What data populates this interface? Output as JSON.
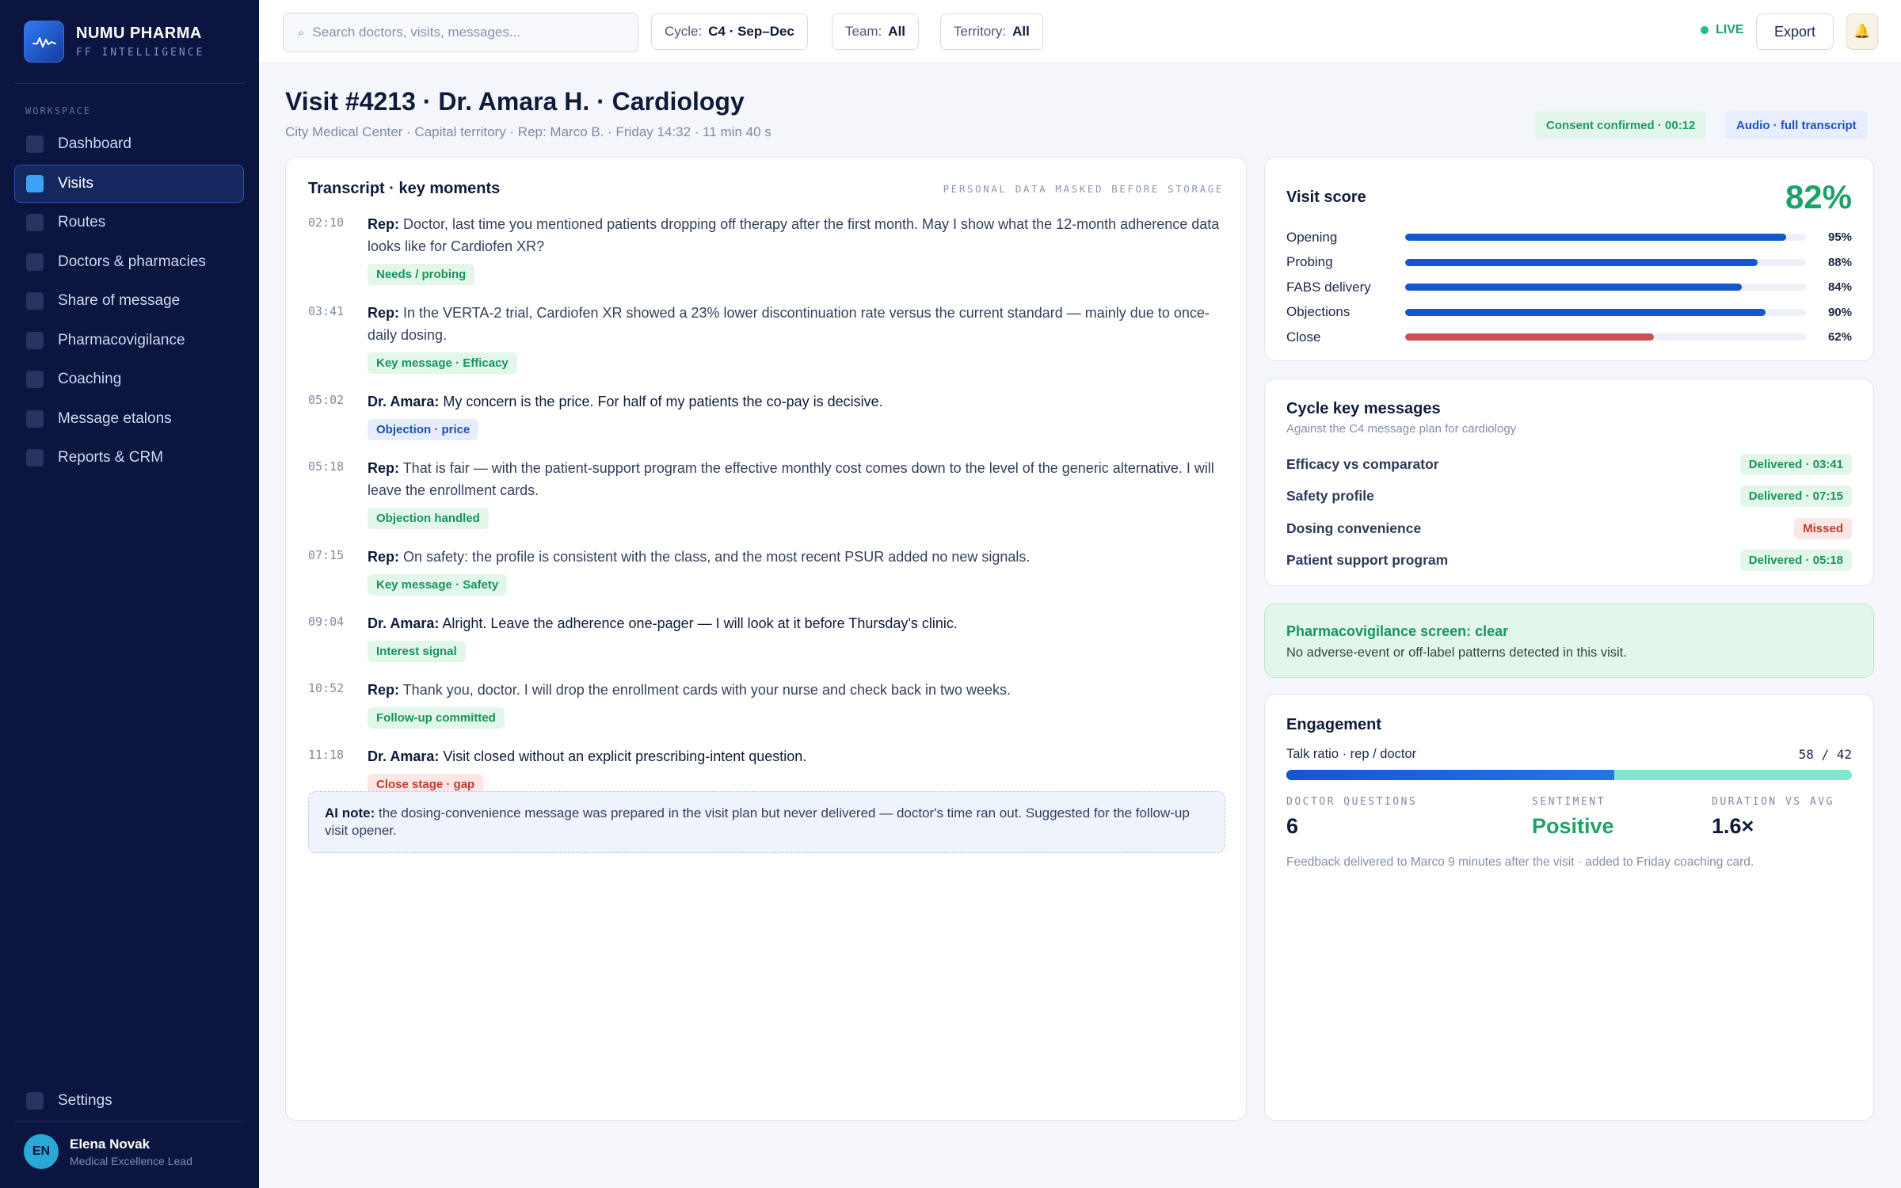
{
  "brand": {
    "name": "NUMU PHARMA",
    "sub": "FF INTELLIGENCE",
    "logo_icon": "waveform-icon"
  },
  "sidebar": {
    "section": "WORKSPACE",
    "items": [
      {
        "label": "Dashboard",
        "active": false
      },
      {
        "label": "Visits",
        "active": true
      },
      {
        "label": "Routes",
        "active": false
      },
      {
        "label": "Doctors & pharmacies",
        "active": false
      },
      {
        "label": "Share of message",
        "active": false
      },
      {
        "label": "Pharmacovigilance",
        "active": false
      },
      {
        "label": "Coaching",
        "active": false
      },
      {
        "label": "Message etalons",
        "active": false
      },
      {
        "label": "Reports & CRM",
        "active": false
      }
    ],
    "settings": "Settings",
    "user": {
      "initials": "EN",
      "name": "Elena Novak",
      "role": "Medical Excellence Lead"
    }
  },
  "topbar": {
    "search_placeholder": "Search doctors, visits, messages...",
    "cycle_label": "Cycle:",
    "cycle_value": "C4 · Sep–Dec",
    "team_label": "Team:",
    "team_value": "All",
    "territory_label": "Territory:",
    "territory_value": "All",
    "live": "LIVE",
    "export": "Export",
    "bell": "🔔"
  },
  "visit": {
    "title": "Visit #4213 · Dr. Amara H. · Cardiology",
    "subtitle": "City Medical Center · Capital territory · Rep: Marco B. · Friday 14:32 · 11 min 40 s",
    "consent_badge": "Consent confirmed · 00:12",
    "audio_badge": "Audio · full transcript"
  },
  "transcript": {
    "title": "Transcript · key moments",
    "mask_note": "PERSONAL DATA MASKED BEFORE STORAGE",
    "moments": [
      {
        "time": "02:10",
        "speaker": "Rep:",
        "is_doctor": false,
        "text": "Doctor, last time you mentioned patients dropping off therapy after the first month. May I show what the 12-month adherence data looks like for Cardiofen XR?",
        "tag": "Needs / probing",
        "tag_kind": "green"
      },
      {
        "time": "03:41",
        "speaker": "Rep:",
        "is_doctor": false,
        "text": "In the VERTA-2 trial, Cardiofen XR showed a 23% lower discontinuation rate versus the current standard — mainly due to once-daily dosing.",
        "tag": "Key message · Efficacy",
        "tag_kind": "green"
      },
      {
        "time": "05:02",
        "speaker": "Dr. Amara:",
        "is_doctor": true,
        "text": "My concern is the price. For half of my patients the co-pay is decisive.",
        "tag": "Objection · price",
        "tag_kind": "blue"
      },
      {
        "time": "05:18",
        "speaker": "Rep:",
        "is_doctor": false,
        "text": "That is fair — with the patient-support program the effective monthly cost comes down to the level of the generic alternative. I will leave the enrollment cards.",
        "tag": "Objection handled",
        "tag_kind": "green"
      },
      {
        "time": "07:15",
        "speaker": "Rep:",
        "is_doctor": false,
        "text": "On safety: the profile is consistent with the class, and the most recent PSUR added no new signals.",
        "tag": "Key message · Safety",
        "tag_kind": "green"
      },
      {
        "time": "09:04",
        "speaker": "Dr. Amara:",
        "is_doctor": true,
        "text": "Alright. Leave the adherence one-pager — I will look at it before Thursday's clinic.",
        "tag": "Interest signal",
        "tag_kind": "green"
      },
      {
        "time": "10:52",
        "speaker": "Rep:",
        "is_doctor": false,
        "text": "Thank you, doctor. I will drop the enrollment cards with your nurse and check back in two weeks.",
        "tag": "Follow-up committed",
        "tag_kind": "green"
      },
      {
        "time": "11:18",
        "speaker": "Dr. Amara:",
        "is_doctor": true,
        "text": "Visit closed without an explicit prescribing-intent question.",
        "tag": "Close stage · gap",
        "tag_kind": "red"
      }
    ],
    "ai_note_label": "AI note:",
    "ai_note_text": "the dosing-convenience message was prepared in the visit plan but never delivered — doctor's time ran out. Suggested for the follow-up visit opener."
  },
  "score": {
    "title": "Visit score",
    "total": "82%",
    "rows": [
      {
        "label": "Opening",
        "value": 95,
        "display": "95%",
        "color": "#1257d1"
      },
      {
        "label": "Probing",
        "value": 88,
        "display": "88%",
        "color": "#1257d1"
      },
      {
        "label": "FABS delivery",
        "value": 84,
        "display": "84%",
        "color": "#1257d1"
      },
      {
        "label": "Objections",
        "value": 90,
        "display": "90%",
        "color": "#1257d1"
      },
      {
        "label": "Close",
        "value": 62,
        "display": "62%",
        "color": "#c8524e"
      }
    ]
  },
  "messages": {
    "title": "Cycle key messages",
    "subtitle": "Against the C4 message plan for cardiology",
    "rows": [
      {
        "label": "Efficacy vs comparator",
        "status": "Delivered · 03:41",
        "kind": "delivered"
      },
      {
        "label": "Safety profile",
        "status": "Delivered · 07:15",
        "kind": "delivered"
      },
      {
        "label": "Dosing convenience",
        "status": "Missed",
        "kind": "missed"
      },
      {
        "label": "Patient support program",
        "status": "Delivered · 05:18",
        "kind": "delivered"
      }
    ]
  },
  "pv": {
    "title": "Pharmacovigilance screen: clear",
    "text": "No adverse-event or off-label patterns detected in this visit."
  },
  "engagement": {
    "title": "Engagement",
    "talk_label": "Talk ratio · rep / doctor",
    "talk_value": "58 / 42",
    "rep_share": 58,
    "stats": [
      {
        "label": "DOCTOR QUESTIONS",
        "value": "6",
        "positive": false
      },
      {
        "label": "SENTIMENT",
        "value": "Positive",
        "positive": true
      },
      {
        "label": "DURATION VS AVG",
        "value": "1.6×",
        "positive": false
      }
    ],
    "footer": "Feedback delivered to Marco 9 minutes after the visit · added to Friday coaching card."
  },
  "colors": {
    "sidebar_bg": "#0b1540",
    "accent": "#1257d1",
    "positive": "#1ea26a",
    "negative": "#c8524e"
  }
}
